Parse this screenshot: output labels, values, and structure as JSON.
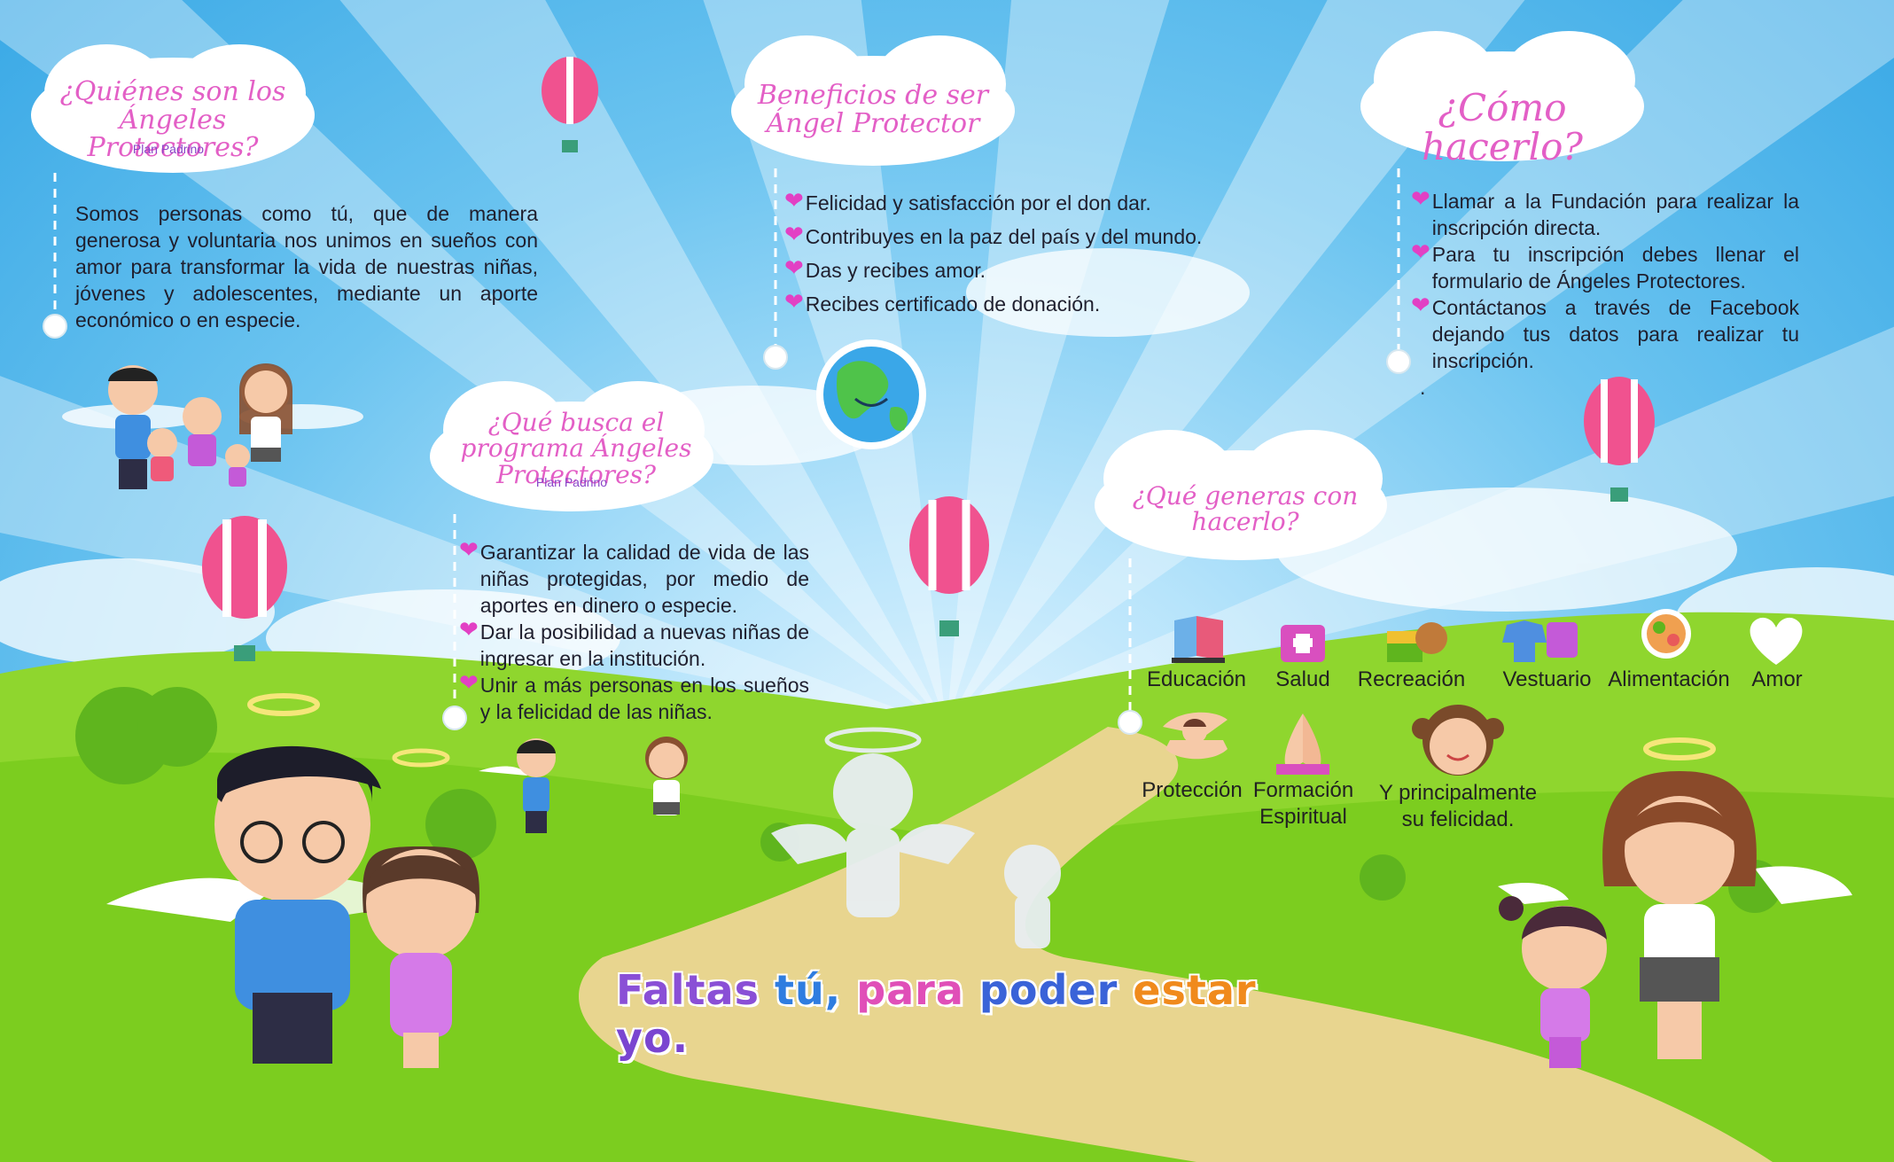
{
  "section_who": {
    "title": "¿Quiénes son los Ángeles Protectores?",
    "subtitle": "Plan Padrino",
    "text": "Somos personas como tú, que de manera generosa y voluntaria nos unimos en sueños con amor para transformar la vida de nuestras niñas, jóvenes y adolescentes, mediante un aporte económico o en especie."
  },
  "section_program": {
    "title": "¿Qué busca el programa Ángeles Protectores?",
    "subtitle": "Plan Padrino",
    "items": [
      "Garantizar la calidad de vida de las niñas protegidas, por medio de aportes en dinero o especie.",
      "Dar la posibilidad a nuevas niñas de ingresar en la institución.",
      "Unir a más personas en los sueños y la felicidad de las niñas."
    ]
  },
  "section_benefits": {
    "title": "Beneficios de ser Ángel Protector",
    "items": [
      "Felicidad y satisfacción por el don dar.",
      "Contribuyes en la paz del país y del mundo.",
      "Das y recibes amor.",
      "Recibes certificado de donación."
    ]
  },
  "section_how": {
    "title": "¿Cómo hacerlo?",
    "items": [
      "Llamar a la Fundación para realizar la inscripción directa.",
      "Para tu inscripción debes llenar el formulario de Ángeles Protectores.",
      "Contáctanos a través de Facebook dejando tus datos para realizar tu inscripción."
    ],
    "trailing": "."
  },
  "section_generate": {
    "title": "¿Qué generas con hacerlo?",
    "row1": [
      {
        "label": "Educación",
        "icon": "book-icon"
      },
      {
        "label": "Salud",
        "icon": "medical-kit-icon"
      },
      {
        "label": "Recreación",
        "icon": "toys-icon"
      },
      {
        "label": "Vestuario",
        "icon": "clothes-icon"
      },
      {
        "label": "Alimentación",
        "icon": "food-plate-icon"
      },
      {
        "label": "Amor",
        "icon": "heart-icon"
      }
    ],
    "row2": [
      {
        "label": "Protección",
        "icon": "protected-child-icon"
      },
      {
        "label": "Formación Espiritual",
        "icon": "praying-hands-icon"
      },
      {
        "label": "Y principalmente su felicidad.",
        "icon": "happy-girl-icon"
      }
    ]
  },
  "slogan": {
    "words": [
      "Faltas",
      "tú,",
      "para",
      "poder",
      "estar",
      "yo."
    ],
    "colors": [
      "#8a4fd6",
      "#2f7de0",
      "#e04fb8",
      "#3a63d8",
      "#f08a1c",
      "#7a45d0"
    ]
  },
  "colors": {
    "sky": "#5bbce9",
    "grass": "#8fd62e",
    "title_pink": "#e35fc6",
    "heart": "#e240c4",
    "balloon": "#f0528f"
  }
}
